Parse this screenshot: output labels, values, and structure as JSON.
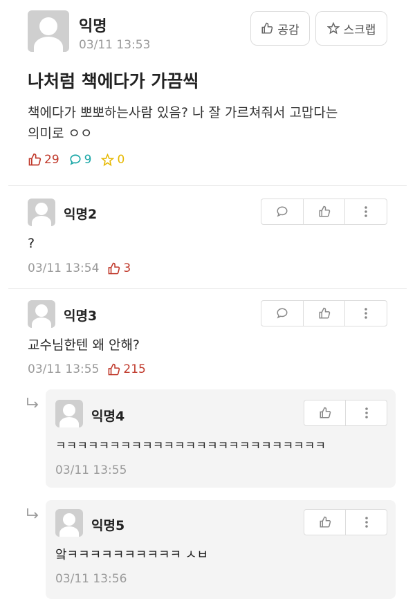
{
  "post": {
    "author": "익명",
    "time": "03/11 13:53",
    "title": "나처럼 책에다가 가끔씩",
    "body_line1": "책에다가 뽀뽀하는사람 있음? 나 잘 가르쳐줘서 고맙다는",
    "body_line2": "의미로 ㅇㅇ",
    "likes": "29",
    "comments": "9",
    "scraps": "0",
    "like_button": "공감",
    "scrap_button": "스크랩"
  },
  "comments": [
    {
      "author": "익명2",
      "text": "?",
      "time": "03/11 13:54",
      "likes": "3"
    },
    {
      "author": "익명3",
      "text": "교수님한텐 왜 안해?",
      "time": "03/11 13:55",
      "likes": "215"
    }
  ],
  "replies": [
    {
      "author": "익명4",
      "text": "ㅋㅋㅋㅋㅋㅋㅋㅋㅋㅋㅋㅋㅋㅋㅋㅋㅋㅋㅋㅋㅋㅋㅋㅋㅋ",
      "time": "03/11 13:55"
    },
    {
      "author": "익명5",
      "text": "앜ㅋㅋㅋㅋㅋㅋㅋㅋㅋㅋ ㅅㅂ",
      "time": "03/11 13:56"
    }
  ],
  "icons": {
    "like": "thumbs-up-icon",
    "comment": "speech-bubble-icon",
    "scrap": "star-icon",
    "more": "more-vertical-icon",
    "reply": "reply-arrow-icon"
  },
  "colors": {
    "like": "#c0392b",
    "comment": "#1aa7a7",
    "scrap": "#e6b800"
  }
}
